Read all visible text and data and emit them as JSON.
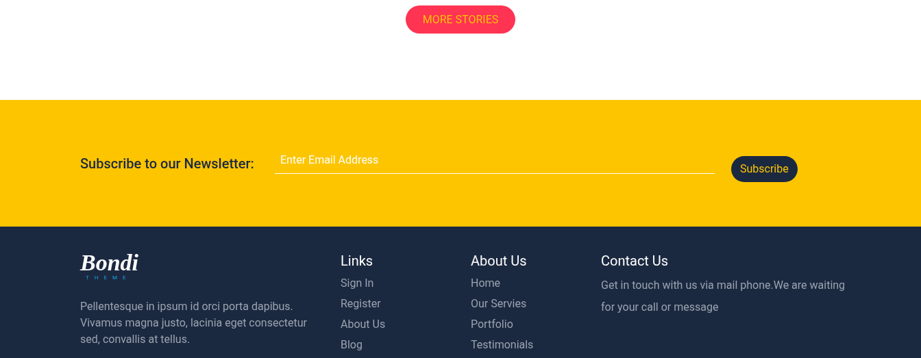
{
  "more_button": {
    "label": "MORE STORIES"
  },
  "newsletter": {
    "label": "Subscribe to our Newsletter:",
    "placeholder": "Enter Email Address",
    "button": "Subscribe"
  },
  "footer": {
    "logo": {
      "name": "Bondi",
      "tagline": "THEME"
    },
    "about_text": "Pellentesque in ipsum id orci porta dapibus. Vivamus magna justo, lacinia eget consectetur sed, convallis at tellus.",
    "columns": [
      {
        "title": "Links",
        "items": [
          "Sign In",
          "Register",
          "About Us",
          "Blog"
        ]
      },
      {
        "title": "About Us",
        "items": [
          "Home",
          "Our Servies",
          "Portfolio",
          "Testimonials"
        ]
      }
    ],
    "contact": {
      "title": "Contact Us",
      "text": "Get in touch with us via mail phone.We are waiting for your call or message"
    }
  }
}
